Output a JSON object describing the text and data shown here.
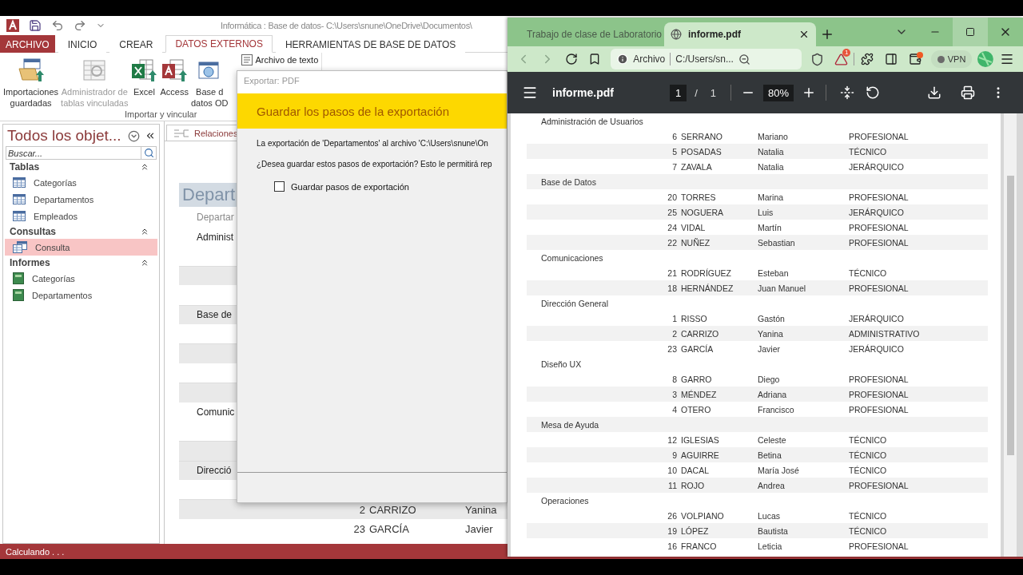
{
  "access": {
    "title": "Informática : Base de datos- C:\\Users\\snune\\OneDrive\\Documentos\\",
    "tabs": [
      {
        "label": "ARCHIVO",
        "kind": "backstage",
        "selected": false
      },
      {
        "label": "INICIO",
        "kind": "tab",
        "selected": false
      },
      {
        "label": "CREAR",
        "kind": "tab",
        "selected": false
      },
      {
        "label": "DATOS EXTERNOS",
        "kind": "tab",
        "selected": true
      },
      {
        "label": "HERRAMIENTAS DE BASE DE DATOS",
        "kind": "tab",
        "selected": false
      }
    ],
    "ribbon": {
      "buttons": [
        {
          "lines": [
            "Importaciones",
            "guardadas"
          ],
          "kind": "saved",
          "disabled": false
        },
        {
          "lines": [
            "Administrador de",
            "tablas vinculadas"
          ],
          "kind": "linked",
          "disabled": true
        },
        {
          "lines": [
            "Excel"
          ],
          "kind": "excel",
          "disabled": false
        },
        {
          "lines": [
            "Access"
          ],
          "kind": "access",
          "disabled": false
        },
        {
          "lines": [
            "Base d",
            "datos OD"
          ],
          "kind": "odbc",
          "disabled": false
        }
      ],
      "small_button": {
        "label": "Archivo de texto"
      },
      "group_label": "Importar y vincular"
    },
    "nav": {
      "title": "Todos los objet...",
      "search": {
        "placeholder": "Buscar..."
      },
      "groups": [
        {
          "label": "Tablas",
          "expanded": true,
          "items": [
            {
              "label": "Categorías",
              "kind": "table",
              "selected": false
            },
            {
              "label": "Departamentos",
              "kind": "table",
              "selected": false
            },
            {
              "label": "Empleados",
              "kind": "table",
              "selected": false
            }
          ]
        },
        {
          "label": "Consultas",
          "expanded": true,
          "items": [
            {
              "label": "Consulta",
              "kind": "query",
              "selected": true
            }
          ]
        },
        {
          "label": "Informes",
          "expanded": true,
          "items": [
            {
              "label": "Categorías",
              "kind": "report",
              "selected": false
            },
            {
              "label": "Departamentos",
              "kind": "report",
              "selected": false
            }
          ]
        }
      ]
    },
    "doc_tabs": [
      {
        "label": "Relaciones"
      }
    ],
    "report": {
      "title": "Depart",
      "caption": "Departar",
      "rows": [
        {
          "kind": "group",
          "text": "Administ",
          "shaded": false
        },
        {
          "kind": "row",
          "shaded": false
        },
        {
          "kind": "row",
          "shaded": true
        },
        {
          "kind": "row",
          "shaded": false
        },
        {
          "kind": "group",
          "text": "Base de",
          "shaded": true
        },
        {
          "kind": "row",
          "shaded": false
        },
        {
          "kind": "row",
          "shaded": true
        },
        {
          "kind": "row",
          "shaded": false
        },
        {
          "kind": "row",
          "shaded": true
        },
        {
          "kind": "group",
          "text": "Comunic",
          "shaded": false
        },
        {
          "kind": "row",
          "shaded": false
        },
        {
          "kind": "row",
          "shaded": true
        },
        {
          "kind": "group",
          "text": "Direcció",
          "shaded": true
        },
        {
          "kind": "row",
          "shaded": false
        },
        {
          "kind": "row",
          "shaded": true,
          "id": "2",
          "surname": "CARRIZO",
          "first": "Yanina"
        },
        {
          "kind": "row",
          "shaded": false,
          "id": "23",
          "surname": "GARCÍA",
          "first": "Javier"
        }
      ]
    },
    "status": "Calculando . . ."
  },
  "dialog": {
    "title": "Exportar: PDF",
    "heading": "Guardar los pasos de la exportación",
    "message": "La exportación de 'Departamentos' al archivo 'C:\\Users\\snune\\On",
    "question": "¿Desea guardar estos pasos de exportación? Esto le permitirá rep",
    "checkbox": {
      "label": "Guardar pasos de exportación",
      "checked": false
    }
  },
  "browser": {
    "tabs": [
      {
        "title": "Trabajo de clase de Laboratorio",
        "kind": "classroom",
        "selected": false
      },
      {
        "title": "informe.pdf",
        "kind": "web",
        "selected": true
      }
    ],
    "window_controls": [
      {
        "kind": "minimize",
        "hovered": false
      },
      {
        "kind": "maximize",
        "hovered": true
      },
      {
        "kind": "close",
        "hovered": false
      }
    ],
    "address": {
      "scheme": "Archivo",
      "url": "C:/Users/sn..."
    },
    "rewards_badge": "1",
    "vpn": {
      "label": "VPN",
      "on": false
    },
    "pdf": {
      "file": "informe.pdf",
      "page": "1",
      "page_separator": "/",
      "pages": "1",
      "zoom": "80%",
      "groups": [
        {
          "name": "Administración de Usuarios",
          "shaded": false,
          "rows": [
            {
              "id": "6",
              "surname": "SERRANO",
              "first": "Mariano",
              "category": "PROFESIONAL",
              "shaded": false
            },
            {
              "id": "5",
              "surname": "POSADAS",
              "first": "Natalia",
              "category": "TÉCNICO",
              "shaded": true
            },
            {
              "id": "7",
              "surname": "ZAVALA",
              "first": "Natalia",
              "category": "JERÁRQUICO",
              "shaded": false
            }
          ]
        },
        {
          "name": "Base de Datos",
          "shaded": true,
          "rows": [
            {
              "id": "20",
              "surname": "TORRES",
              "first": "Marina",
              "category": "PROFESIONAL",
              "shaded": false
            },
            {
              "id": "25",
              "surname": "NOGUERA",
              "first": "Luis",
              "category": "JERÁRQUICO",
              "shaded": true
            },
            {
              "id": "24",
              "surname": "VIDAL",
              "first": "Martín",
              "category": "PROFESIONAL",
              "shaded": false
            },
            {
              "id": "22",
              "surname": "NUÑEZ",
              "first": "Sebastian",
              "category": "PROFESIONAL",
              "shaded": true
            }
          ]
        },
        {
          "name": "Comunicaciones",
          "shaded": false,
          "rows": [
            {
              "id": "21",
              "surname": "RODRÍGUEZ",
              "first": "Esteban",
              "category": "TÉCNICO",
              "shaded": false
            },
            {
              "id": "18",
              "surname": "HERNÁNDEZ",
              "first": "Juan Manuel",
              "category": "PROFESIONAL",
              "shaded": true
            }
          ]
        },
        {
          "name": "Dirección General",
          "shaded": false,
          "rows": [
            {
              "id": "1",
              "surname": "RISSO",
              "first": "Gastón",
              "category": "JERÁRQUICO",
              "shaded": false
            },
            {
              "id": "2",
              "surname": "CARRIZO",
              "first": "Yanina",
              "category": "ADMINISTRATIVO",
              "shaded": true
            },
            {
              "id": "23",
              "surname": "GARCÍA",
              "first": "Javier",
              "category": "JERÁRQUICO",
              "shaded": false
            }
          ]
        },
        {
          "name": "Diseño UX",
          "shaded": false,
          "rows": [
            {
              "id": "8",
              "surname": "GARRO",
              "first": "Diego",
              "category": "PROFESIONAL",
              "shaded": false
            },
            {
              "id": "3",
              "surname": "MÉNDEZ",
              "first": "Adriana",
              "category": "PROFESIONAL",
              "shaded": true
            },
            {
              "id": "4",
              "surname": "OTERO",
              "first": "Francisco",
              "category": "PROFESIONAL",
              "shaded": false
            }
          ]
        },
        {
          "name": "Mesa de Ayuda",
          "shaded": true,
          "rows": [
            {
              "id": "12",
              "surname": "IGLESIAS",
              "first": "Celeste",
              "category": "TÉCNICO",
              "shaded": false
            },
            {
              "id": "9",
              "surname": "AGUIRRE",
              "first": "Betina",
              "category": "TÉCNICO",
              "shaded": true
            },
            {
              "id": "10",
              "surname": "DACAL",
              "first": "María José",
              "category": "TÉCNICO",
              "shaded": false
            },
            {
              "id": "11",
              "surname": "ROJO",
              "first": "Andrea",
              "category": "PROFESIONAL",
              "shaded": true
            }
          ]
        },
        {
          "name": "Operaciones",
          "shaded": false,
          "rows": [
            {
              "id": "26",
              "surname": "VOLPIANO",
              "first": "Lucas",
              "category": "TÉCNICO",
              "shaded": false
            },
            {
              "id": "19",
              "surname": "LÓPEZ",
              "first": "Bautista",
              "category": "TÉCNICO",
              "shaded": true
            },
            {
              "id": "16",
              "surname": "FRANCO",
              "first": "Leticia",
              "category": "PROFESIONAL",
              "shaded": false
            }
          ]
        }
      ]
    }
  }
}
